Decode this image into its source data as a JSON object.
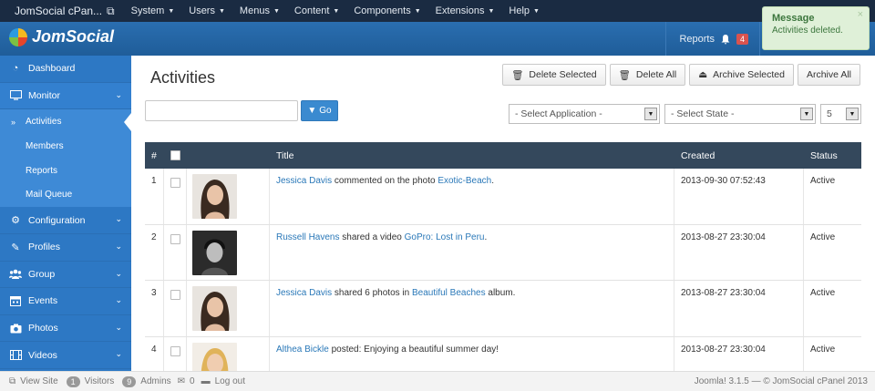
{
  "topbar": {
    "site_title": "JomSocial cPan...",
    "menu": [
      "System",
      "Users",
      "Menus",
      "Content",
      "Components",
      "Extensions",
      "Help"
    ]
  },
  "header": {
    "logo_text": "JomSocial",
    "reports_label": "Reports",
    "reports_count": "4"
  },
  "message": {
    "title": "Message",
    "text": "Activities deleted.",
    "close": "×"
  },
  "sidebar": {
    "dashboard": "Dashboard",
    "monitor": "Monitor",
    "monitor_items": [
      "Activities",
      "Members",
      "Reports",
      "Mail Queue"
    ],
    "configuration": "Configuration",
    "profiles": "Profiles",
    "group": "Group",
    "events": "Events",
    "photos": "Photos",
    "videos": "Videos"
  },
  "page": {
    "title": "Activities",
    "toolbar": {
      "delete_selected": "Delete Selected",
      "delete_all": "Delete All",
      "archive_selected": "Archive Selected",
      "archive_all": "Archive All"
    },
    "filters": {
      "go_label": "Go",
      "select_application": "- Select Application -",
      "select_state": "- Select State -",
      "limit": "5"
    }
  },
  "table": {
    "headers": {
      "num": "#",
      "title": "Title",
      "created": "Created",
      "status": "Status"
    },
    "rows": [
      {
        "num": "1",
        "actor": "Jessica Davis",
        "action": " commented on the photo ",
        "object": "Exotic-Beach",
        "suffix": ".",
        "created": "2013-09-30 07:52:43",
        "status": "Active"
      },
      {
        "num": "2",
        "actor": "Russell Havens",
        "action": " shared a video ",
        "object": "GoPro: Lost in Peru",
        "suffix": ".",
        "created": "2013-08-27 23:30:04",
        "status": "Active"
      },
      {
        "num": "3",
        "actor": "Jessica Davis",
        "action": " shared 6 photos in ",
        "object": "Beautiful Beaches",
        "suffix": " album.",
        "created": "2013-08-27 23:30:04",
        "status": "Active"
      },
      {
        "num": "4",
        "actor": "Althea Bickle",
        "action": " posted: Enjoying a beautiful summer day!",
        "object": "",
        "suffix": "",
        "created": "2013-08-27 23:30:04",
        "status": "Active"
      }
    ]
  },
  "footer": {
    "view_site": "View Site",
    "visitors_count": "1",
    "visitors_label": "Visitors",
    "admins_count": "9",
    "admins_label": "Admins",
    "messages_count": "0",
    "logout": "Log out",
    "version": "Joomla! 3.1.5 — © JomSocial cPanel 2013"
  }
}
